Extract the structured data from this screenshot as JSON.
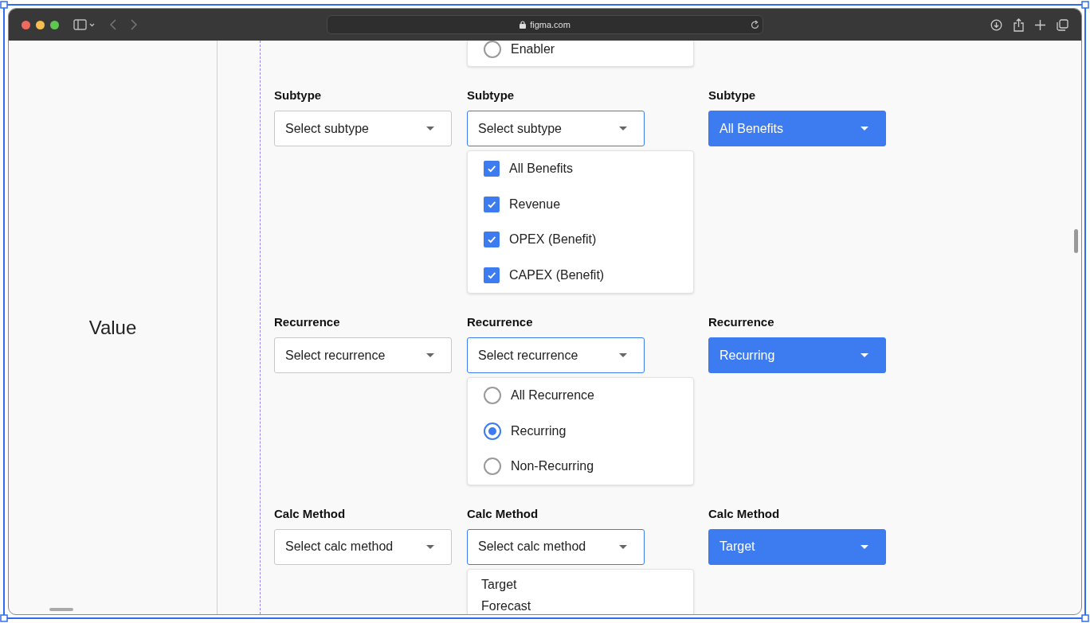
{
  "browser": {
    "url": "figma.com"
  },
  "side_label": "Value",
  "top_menu": {
    "items": [
      {
        "label": "Enabler",
        "kind": "radio",
        "selected": false
      }
    ]
  },
  "sections": [
    {
      "fields": [
        {
          "label": "Subtype",
          "kind": "default",
          "value": "Select subtype"
        },
        {
          "label": "Subtype",
          "kind": "focused",
          "value": "Select subtype"
        },
        {
          "label": "Subtype",
          "kind": "filled",
          "value": "All Benefits"
        }
      ],
      "menu": [
        {
          "label": "All Benefits",
          "kind": "checkbox",
          "checked": true
        },
        {
          "label": "Revenue",
          "kind": "checkbox",
          "checked": true
        },
        {
          "label": "OPEX (Benefit)",
          "kind": "checkbox",
          "checked": true
        },
        {
          "label": "CAPEX (Benefit)",
          "kind": "checkbox",
          "checked": true
        }
      ]
    },
    {
      "fields": [
        {
          "label": "Recurrence",
          "kind": "default",
          "value": "Select recurrence"
        },
        {
          "label": "Recurrence",
          "kind": "focused",
          "value": "Select recurrence"
        },
        {
          "label": "Recurrence",
          "kind": "filled",
          "value": "Recurring"
        }
      ],
      "menu": [
        {
          "label": "All Recurrence",
          "kind": "radio",
          "selected": false
        },
        {
          "label": "Recurring",
          "kind": "radio",
          "selected": true
        },
        {
          "label": "Non-Recurring",
          "kind": "radio",
          "selected": false
        }
      ]
    },
    {
      "fields": [
        {
          "label": "Calc Method",
          "kind": "default",
          "value": "Select calc method"
        },
        {
          "label": "Calc Method",
          "kind": "focused",
          "value": "Select calc method"
        },
        {
          "label": "Calc Method",
          "kind": "filled",
          "value": "Target"
        }
      ],
      "menu": [
        {
          "label": "Target",
          "kind": "plain"
        },
        {
          "label": "Forecast",
          "kind": "plain"
        }
      ]
    }
  ]
}
